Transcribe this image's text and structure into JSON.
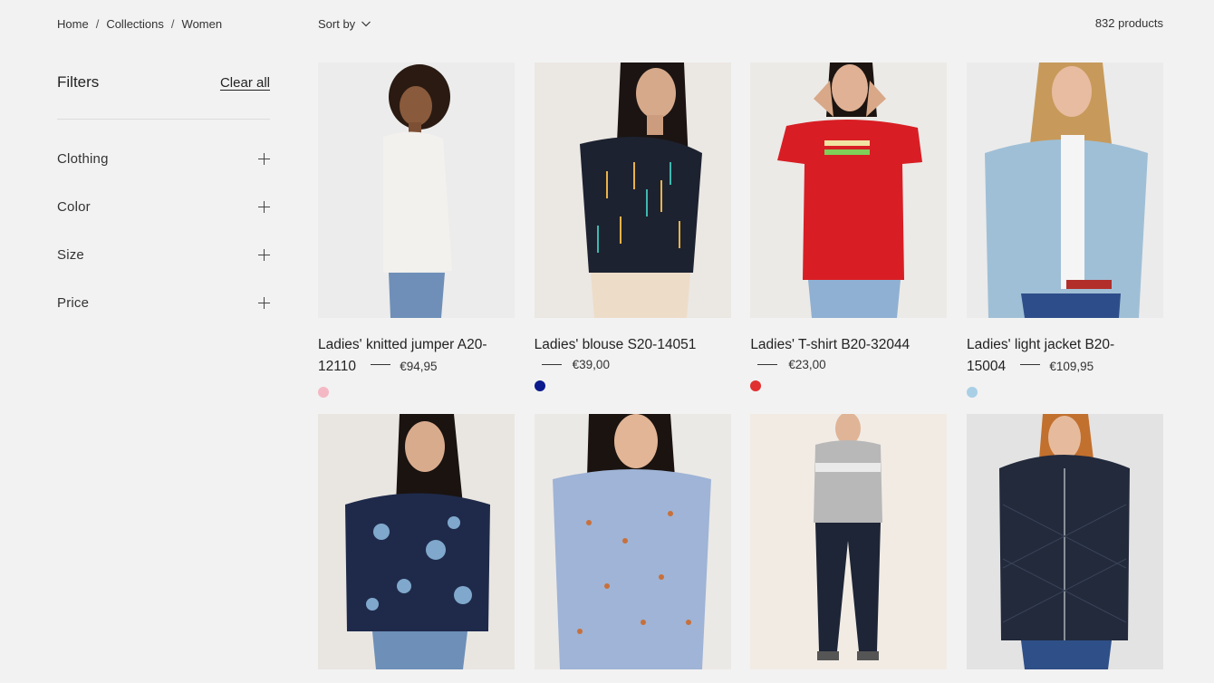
{
  "breadcrumb": {
    "items": [
      "Home",
      "Collections",
      "Women"
    ],
    "separator": "/"
  },
  "sort": {
    "label": "Sort by",
    "icon": "chevron-down-icon"
  },
  "count_label": "832 products",
  "filters": {
    "title": "Filters",
    "clear_label": "Clear all",
    "groups": [
      "Clothing",
      "Color",
      "Size",
      "Price"
    ],
    "expand_icon": "plus-icon"
  },
  "products": [
    {
      "name_line1": "Ladies' knitted jumper A20-",
      "name_line2": "12110",
      "price": "€94,95",
      "swatch": "#f4b8c4",
      "photo_bg": "#ececec",
      "garment": "#f3f1ee"
    },
    {
      "name_line1": "Ladies' blouse S20-14051",
      "name_line2": "",
      "price": "€39,00",
      "swatch": "#0b1a8c",
      "photo_bg": "#ebe7e3",
      "garment": "#1d2230"
    },
    {
      "name_line1": "Ladies' T-shirt B20-32044",
      "name_line2": "",
      "price": "€23,00",
      "swatch": "#e03030",
      "photo_bg": "#eceae7",
      "garment": "#d81e24"
    },
    {
      "name_line1": "Ladies' light jacket B20-",
      "name_line2": "15004",
      "price": "€109,95",
      "swatch": "#a9cfe6",
      "photo_bg": "#ebebeb",
      "garment": "#9fbfd6"
    },
    {
      "photo_bg": "#e9e6e2",
      "garment": "#1f2a4a"
    },
    {
      "photo_bg": "#ebe9e6",
      "garment": "#9fb4d6"
    },
    {
      "photo_bg": "#f1ebe4",
      "garment": "#b8b8b8"
    },
    {
      "photo_bg": "#e3e3e3",
      "garment": "#222a3c"
    }
  ]
}
